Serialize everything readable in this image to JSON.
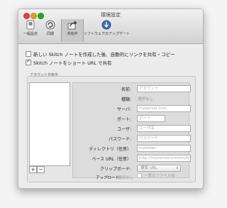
{
  "window": {
    "title": "環境設定"
  },
  "toolbar": {
    "items": [
      {
        "label": "一般設定",
        "icon": "switch-icon"
      },
      {
        "label": "同期",
        "icon": "sync-icon"
      },
      {
        "label": "共有中",
        "icon": "share-icon"
      },
      {
        "label": "ソフトウェアのアップデート",
        "icon": "update-icon"
      }
    ],
    "selected": "共有中"
  },
  "options": {
    "copy_link_label": "新しい Skitch ノートを作成した後、自動的にリンクを共有・コピー",
    "copy_link_checked": false,
    "short_url_label": "Skitch ノートをショート URL で共有",
    "short_url_checked": true
  },
  "account_sharing": {
    "group_label": "アカウント共有中",
    "add_label": "+",
    "remove_label": "−",
    "fields": {
      "name_label": "名前:",
      "name_placeholder": "アカウント",
      "type_label": "種類:",
      "type_value": "選択なし",
      "server_label": "サーバ:",
      "server_placeholder": "myserver.com",
      "port_label": "ポート:",
      "port_placeholder": "ポート",
      "user_label": "ユーザ:",
      "user_placeholder": "ユーザ名",
      "password_label": "パスワード:",
      "password_placeholder": "パスワード",
      "directory_label": "ディレクトリ（任意）",
      "directory_placeholder": "myfolder",
      "base_url_label": "ベース URL（任意）",
      "base_url_placeholder": "http://myserver.com/myfolder/",
      "clipboard_label": "クリップボード:",
      "clipboard_value": "標準 URL",
      "unique_filename_label": "一意のファイル名",
      "upload_label": "アップロード",
      "upload_value": "選択なし"
    }
  }
}
